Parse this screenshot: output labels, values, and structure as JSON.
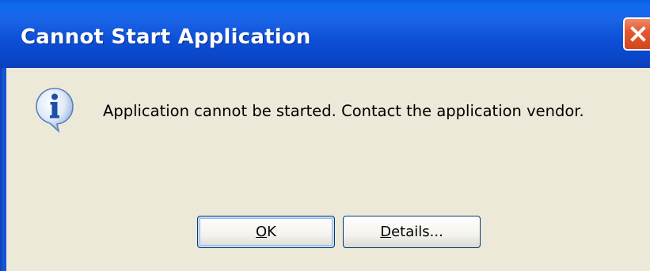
{
  "window": {
    "title": "Cannot Start Application",
    "close_label": "Close"
  },
  "dialog": {
    "icon": "info-icon",
    "message": "Application cannot be started. Contact the application vendor."
  },
  "buttons": {
    "ok": {
      "mnemonic": "O",
      "rest": "K"
    },
    "details": {
      "mnemonic": "D",
      "rest": "etails..."
    }
  },
  "colors": {
    "titlebar": "#0c4fd6",
    "close": "#e5582e",
    "body": "#ece9d8",
    "button_border": "#003c74"
  }
}
